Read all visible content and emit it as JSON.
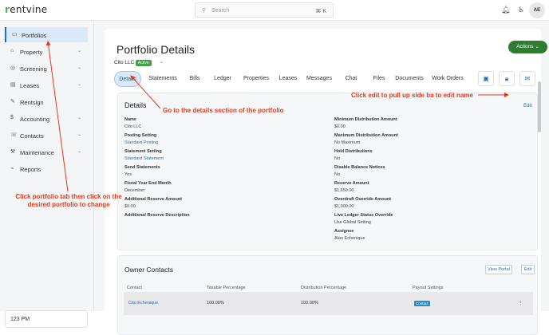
{
  "topbar": {
    "logo_prefix": "r",
    "logo_rest": "entvine",
    "search_placeholder": "Search",
    "search_shortcut": "⌘ K",
    "avatar_initials": "AE"
  },
  "sidebar": {
    "items": [
      {
        "label": "Portfolios",
        "icon": "folder-icon",
        "glyph": "▭",
        "has_chevron": false
      },
      {
        "label": "Property",
        "icon": "building-icon",
        "glyph": "⌂",
        "has_chevron": true
      },
      {
        "label": "Screening",
        "icon": "screening-icon",
        "glyph": "◎",
        "has_chevron": true
      },
      {
        "label": "Leases",
        "icon": "document-icon",
        "glyph": "▤",
        "has_chevron": true
      },
      {
        "label": "Rentsign",
        "icon": "pen-icon",
        "glyph": "✎",
        "has_chevron": false
      },
      {
        "label": "Accounting",
        "icon": "dollar-icon",
        "glyph": "$",
        "has_chevron": true
      },
      {
        "label": "Contacts",
        "icon": "contacts-icon",
        "glyph": "☏",
        "has_chevron": true
      },
      {
        "label": "Maintenance",
        "icon": "wrench-icon",
        "glyph": "⚒",
        "has_chevron": true
      },
      {
        "label": "Reports",
        "icon": "chart-icon",
        "glyph": "⌁",
        "has_chevron": false
      }
    ],
    "clock": "123 PM"
  },
  "header": {
    "title": "Portfolio Details",
    "actions_label": "Actions",
    "entity_name": "Cito LLC",
    "entity_status": "Active"
  },
  "tabs": [
    "Details",
    "Statements",
    "Bills",
    "Ledger",
    "Properties",
    "Leases",
    "Messages",
    "Chat",
    "Files",
    "Documents",
    "Work Orders"
  ],
  "details": {
    "title": "Details",
    "edit_label": "Edit",
    "left": [
      {
        "label": "Name",
        "value": "Cito LLC",
        "link": false
      },
      {
        "label": "Posting Setting",
        "value": "Standard Posting",
        "link": true
      },
      {
        "label": "Statement Setting",
        "value": "Standard Statement",
        "link": true
      },
      {
        "label": "Send Statements",
        "value": "Yes",
        "link": false
      },
      {
        "label": "Fiscal Year End Month",
        "value": "December",
        "link": false
      },
      {
        "label": "Additional Reserve Amount",
        "value": "$0.00",
        "link": false
      },
      {
        "label": "Additional Reserve Description",
        "value": "",
        "link": false
      }
    ],
    "right": [
      {
        "label": "Minimum Distribution Amount",
        "value": "$0.00"
      },
      {
        "label": "Maximum Distribution Amount",
        "value": "No Maximum"
      },
      {
        "label": "Hold Distributions",
        "value": "No"
      },
      {
        "label": "Disable Balance Notices",
        "value": "No"
      },
      {
        "label": "Reserve Amount",
        "value": "$1,650.00"
      },
      {
        "label": "Overdraft Override Amount",
        "value": "$1,000.00"
      },
      {
        "label": "Live Ledger Status Override",
        "value": "Use Global Setting"
      },
      {
        "label": "Assignee",
        "value": "Alan Echenique"
      }
    ]
  },
  "owner_contacts": {
    "title": "Owner Contacts",
    "view_portal_label": "View Portal",
    "edit_label": "Edit",
    "columns": [
      "Contact",
      "Taxable Percentage",
      "Distribution Percentage",
      "Payout Settings"
    ],
    "rows": [
      {
        "contact": "Cito Echenique",
        "taxable": "100.00%",
        "distribution": "100.00%",
        "payout": "Contact"
      }
    ]
  },
  "annotations": {
    "portfolio_tab": "Click portfolio tab then click on the desired portfolio to change",
    "details_section": "Go to the details section of the portfolio",
    "edit": "Click edit to pull up side ba to edit name"
  },
  "colors": {
    "brand_green": "#2e7d32",
    "accent_blue": "#2b6cb0",
    "annotation_red": "#e8391a",
    "active_bg": "#dbe8f7"
  }
}
